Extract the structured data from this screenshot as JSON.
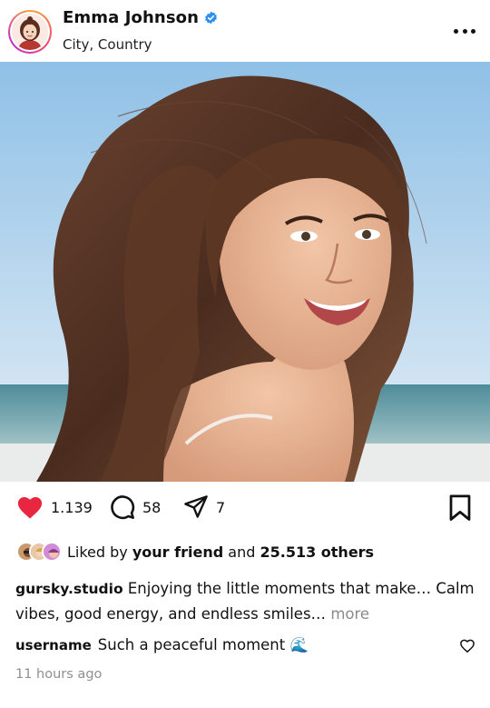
{
  "profile": {
    "name": "Emma Johnson",
    "location": "City, Country",
    "verified": true
  },
  "actions": {
    "likes_count": "1.139",
    "comments_count": "58",
    "shares_count": "7"
  },
  "likes": {
    "prefix": "Liked by",
    "friend": "your friend",
    "connector": "and",
    "others": "25.513 others"
  },
  "caption": {
    "username": "gursky.studio",
    "text": "Enjoying the little moments that make… Calm vibes, good energy, and endless smiles…",
    "more": "more"
  },
  "comment": {
    "username": "username",
    "text": "Such a peaceful moment 🌊"
  },
  "timestamp": "11 hours ago",
  "colors": {
    "like_red": "#e8263f",
    "verified_blue": "#2d8ff0",
    "muted": "#8a8a8a"
  },
  "icons": [
    "more-icon",
    "heart-icon",
    "comment-icon",
    "share-icon",
    "bookmark-icon",
    "verified-icon",
    "comment-like-icon"
  ]
}
